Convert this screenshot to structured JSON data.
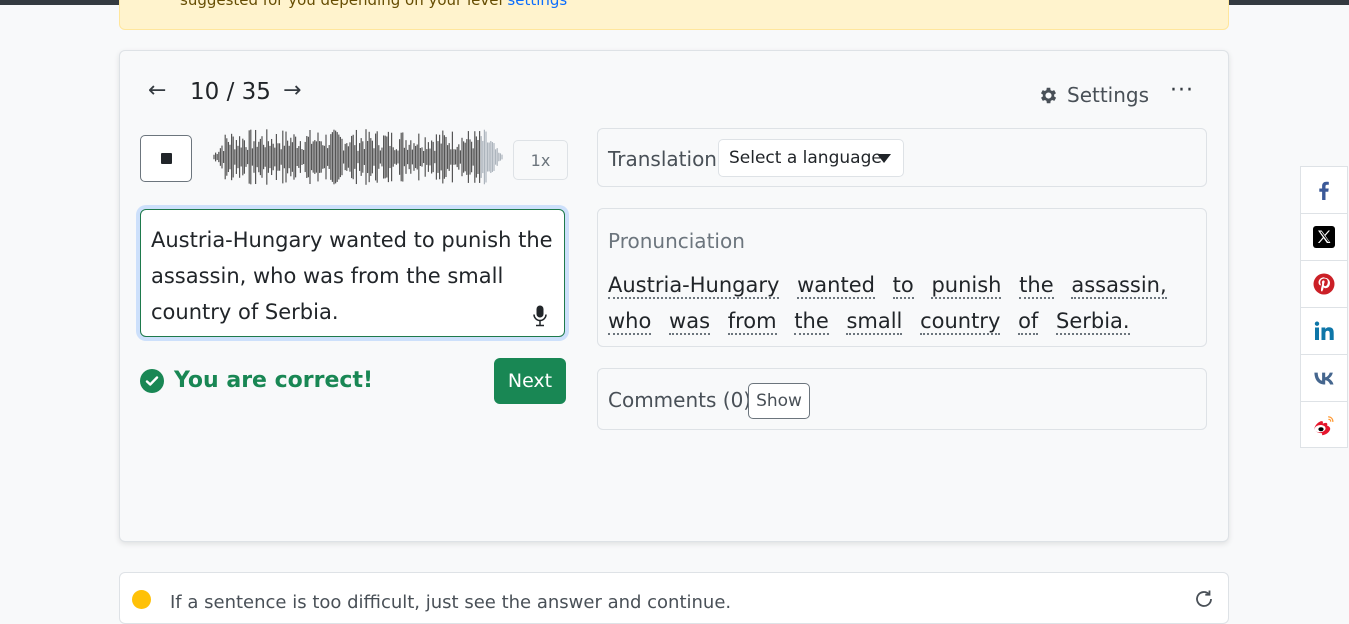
{
  "top_alert": {
    "text_before": "suggested for you depending on your level ",
    "link": "settings"
  },
  "navigation": {
    "prev_icon": "←",
    "counter": "10 / 35",
    "next_icon": "→"
  },
  "header": {
    "settings_label": "Settings",
    "more_icon": "···"
  },
  "player": {
    "speed_label": "1x"
  },
  "answer": {
    "text": "Austria-Hungary wanted to punish the assassin, who was from the small country of Serbia."
  },
  "result": {
    "message": "You are correct!",
    "next_label": "Next"
  },
  "translation": {
    "label": "Translation",
    "select_value": "Select a language"
  },
  "pronunciation": {
    "label": "Pronunciation",
    "words": [
      "Austria-Hungary",
      "wanted",
      "to",
      "punish",
      "the",
      "assassin,",
      "who",
      "was",
      "from",
      "the",
      "small",
      "country",
      "of",
      "Serbia."
    ]
  },
  "comments": {
    "label": "Comments (0)",
    "show_label": "Show"
  },
  "share": [
    "facebook-icon",
    "x-icon",
    "pinterest-icon",
    "linkedin-icon",
    "vk-icon",
    "weibo-icon"
  ],
  "tip": {
    "text": "If a sentence is too difficult, just see the answer and continue."
  },
  "colors": {
    "success": "#198754",
    "alert_bg": "#fff3cd",
    "link": "#0d6efd"
  }
}
